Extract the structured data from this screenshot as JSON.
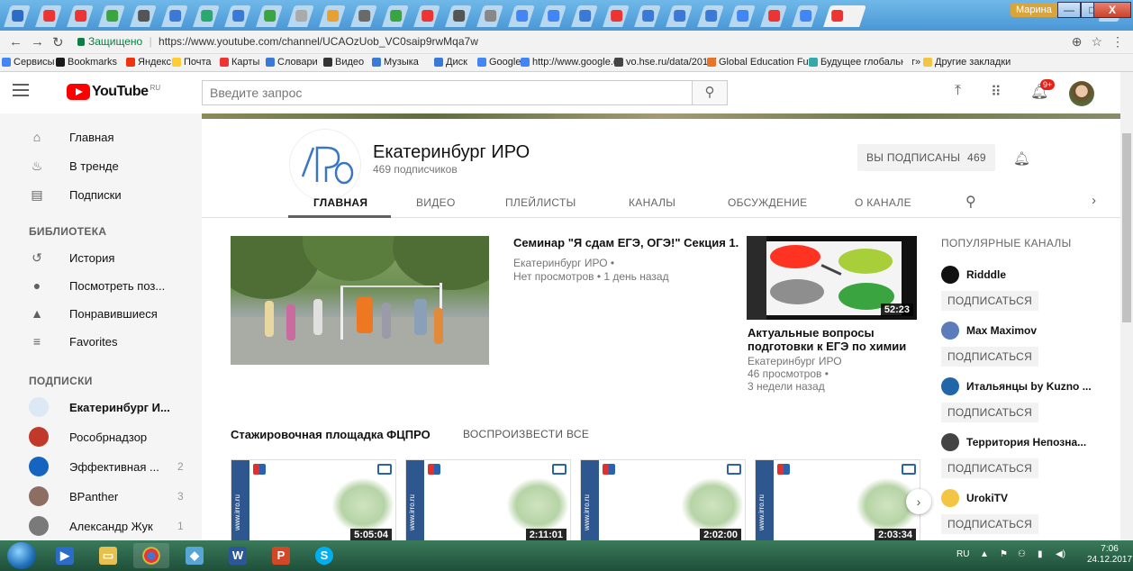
{
  "browser": {
    "url_secure_label": "Защищено",
    "url": "https://www.youtube.com/channel/UCAOzUob_VC0saip9rwMqa7w",
    "user_badge": "Марина",
    "window_buttons": {
      "minimize": "—",
      "maximize": "□",
      "close": "X"
    },
    "bookmarks": [
      {
        "label": "Сервисы",
        "color": "#4285f4"
      },
      {
        "label": "Bookmarks",
        "color": "#1a1a1a"
      },
      {
        "label": "Яндекс",
        "color": "#e31"
      },
      {
        "label": "Почта",
        "color": "#fc3"
      },
      {
        "label": "Карты",
        "color": "#e33"
      },
      {
        "label": "Словари",
        "color": "#3a7ad6"
      },
      {
        "label": "Видео",
        "color": "#333"
      },
      {
        "label": "Музыка",
        "color": "#3a7ad6"
      },
      {
        "label": "Диск",
        "color": "#3a7ad6"
      },
      {
        "label": "Google",
        "color": "#4285f4"
      },
      {
        "label": "http://www.google.co",
        "color": "#4285f4"
      },
      {
        "label": "vo.hse.ru/data/2010/",
        "color": "#444"
      },
      {
        "label": "Global Education Futu",
        "color": "#e8742a"
      },
      {
        "label": "Будущее глобальног",
        "color": "#3aa"
      },
      {
        "label": "»",
        "color": "#f2f2f2"
      },
      {
        "label": "Другие закладки",
        "color": "#f4c542"
      }
    ]
  },
  "masthead": {
    "logo_text": "YouTube",
    "logo_region": "RU",
    "search_placeholder": "Введите запрос",
    "notification_count": "9+"
  },
  "sidebar": {
    "main_items": [
      {
        "label": "Главная",
        "icon": "home-icon",
        "glyph": "⌂"
      },
      {
        "label": "В тренде",
        "icon": "trending-icon",
        "glyph": "♨"
      },
      {
        "label": "Подписки",
        "icon": "subscriptions-icon",
        "glyph": "▤"
      }
    ],
    "library_heading": "БИБЛИОТЕКА",
    "library_items": [
      {
        "label": "История",
        "icon": "history-icon",
        "glyph": "↺"
      },
      {
        "label": "Посмотреть поз...",
        "icon": "watch-later-icon",
        "glyph": "●"
      },
      {
        "label": "Понравившиеся",
        "icon": "liked-icon",
        "glyph": "▲"
      },
      {
        "label": "Favorites",
        "icon": "playlist-icon",
        "glyph": "≡"
      }
    ],
    "subs_heading": "ПОДПИСКИ",
    "subscriptions": [
      {
        "label": "Екатеринбург И...",
        "count": "",
        "color": "#dde8f5",
        "bold": true
      },
      {
        "label": "Рособрнадзор",
        "count": "",
        "color": "#c0392b",
        "bold": false
      },
      {
        "label": "Эффективная ...",
        "count": "2",
        "color": "#1565c0",
        "bold": false
      },
      {
        "label": "BPanther",
        "count": "3",
        "color": "#8d6e63",
        "bold": false
      },
      {
        "label": "Александр Жук",
        "count": "1",
        "color": "#7a7a7a",
        "bold": false
      }
    ]
  },
  "channel": {
    "name": "Екатеринбург ИРО",
    "subscribers": "469 подписчиков",
    "subscribed_label": "ВЫ ПОДПИСАНЫ",
    "subscribed_count": "469",
    "tabs": [
      "ГЛАВНАЯ",
      "ВИДЕО",
      "ПЛЕЙЛИСТЫ",
      "КАНАЛЫ",
      "ОБСУЖДЕНИЕ",
      "О КАНАЛЕ"
    ]
  },
  "featured": {
    "title": "Семинар \"Я сдам ЕГЭ, ОГЭ!\" Секция 1.",
    "author": "Екатеринбург ИРО •",
    "meta": "Нет просмотров • 1 день назад"
  },
  "recent": {
    "title": "Актуальные вопросы подготовки к ЕГЭ по химии",
    "duration": "52:23",
    "author": "Екатеринбург ИРО",
    "views": "46 просмотров •",
    "age": "3 недели назад"
  },
  "popular": {
    "heading": "ПОПУЛЯРНЫЕ КАНАЛЫ",
    "subscribe_label": "ПОДПИСАТЬСЯ",
    "channels": [
      {
        "name": "Ridddle",
        "color": "#111"
      },
      {
        "name": "Max Maximov",
        "color": "#5c7cba"
      },
      {
        "name": "Итальянцы by Kuzno ...",
        "color": "#2266aa"
      },
      {
        "name": "Территория Непозна...",
        "color": "#444"
      },
      {
        "name": "UrokiTV",
        "color": "#f4c542"
      }
    ]
  },
  "shelf": {
    "title": "Стажировочная площадка ФЦПРО",
    "play_all": "ВОСПРОИЗВЕСТИ ВСЕ",
    "thumbs": [
      {
        "duration": "5:05:04",
        "band_text": "www.irro.ru"
      },
      {
        "duration": "2:11:01",
        "band_text": "www.irro.ru"
      },
      {
        "duration": "2:02:00",
        "band_text": "www.irro.ru"
      },
      {
        "duration": "2:03:34",
        "band_text": "www.irro.ru"
      }
    ]
  },
  "taskbar": {
    "lang": "RU",
    "time": "7:06",
    "date": "24.12.2017"
  }
}
